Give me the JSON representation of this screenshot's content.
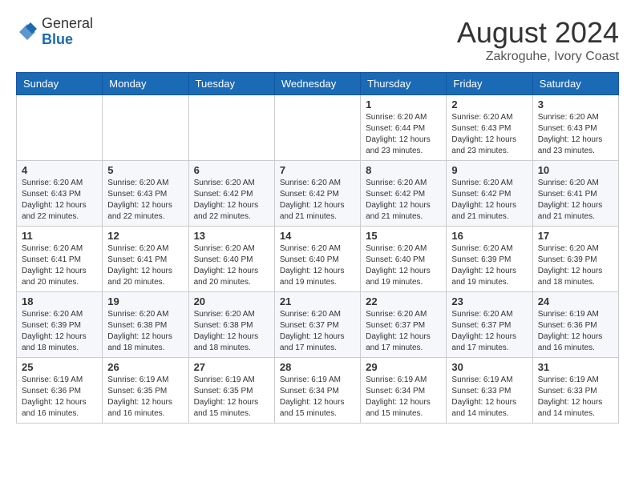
{
  "header": {
    "logo_line1": "General",
    "logo_line2": "Blue",
    "month_year": "August 2024",
    "location": "Zakroguhe, Ivory Coast"
  },
  "weekdays": [
    "Sunday",
    "Monday",
    "Tuesday",
    "Wednesday",
    "Thursday",
    "Friday",
    "Saturday"
  ],
  "weeks": [
    [
      {
        "day": "",
        "info": ""
      },
      {
        "day": "",
        "info": ""
      },
      {
        "day": "",
        "info": ""
      },
      {
        "day": "",
        "info": ""
      },
      {
        "day": "1",
        "info": "Sunrise: 6:20 AM\nSunset: 6:44 PM\nDaylight: 12 hours\nand 23 minutes."
      },
      {
        "day": "2",
        "info": "Sunrise: 6:20 AM\nSunset: 6:43 PM\nDaylight: 12 hours\nand 23 minutes."
      },
      {
        "day": "3",
        "info": "Sunrise: 6:20 AM\nSunset: 6:43 PM\nDaylight: 12 hours\nand 23 minutes."
      }
    ],
    [
      {
        "day": "4",
        "info": "Sunrise: 6:20 AM\nSunset: 6:43 PM\nDaylight: 12 hours\nand 22 minutes."
      },
      {
        "day": "5",
        "info": "Sunrise: 6:20 AM\nSunset: 6:43 PM\nDaylight: 12 hours\nand 22 minutes."
      },
      {
        "day": "6",
        "info": "Sunrise: 6:20 AM\nSunset: 6:42 PM\nDaylight: 12 hours\nand 22 minutes."
      },
      {
        "day": "7",
        "info": "Sunrise: 6:20 AM\nSunset: 6:42 PM\nDaylight: 12 hours\nand 21 minutes."
      },
      {
        "day": "8",
        "info": "Sunrise: 6:20 AM\nSunset: 6:42 PM\nDaylight: 12 hours\nand 21 minutes."
      },
      {
        "day": "9",
        "info": "Sunrise: 6:20 AM\nSunset: 6:42 PM\nDaylight: 12 hours\nand 21 minutes."
      },
      {
        "day": "10",
        "info": "Sunrise: 6:20 AM\nSunset: 6:41 PM\nDaylight: 12 hours\nand 21 minutes."
      }
    ],
    [
      {
        "day": "11",
        "info": "Sunrise: 6:20 AM\nSunset: 6:41 PM\nDaylight: 12 hours\nand 20 minutes."
      },
      {
        "day": "12",
        "info": "Sunrise: 6:20 AM\nSunset: 6:41 PM\nDaylight: 12 hours\nand 20 minutes."
      },
      {
        "day": "13",
        "info": "Sunrise: 6:20 AM\nSunset: 6:40 PM\nDaylight: 12 hours\nand 20 minutes."
      },
      {
        "day": "14",
        "info": "Sunrise: 6:20 AM\nSunset: 6:40 PM\nDaylight: 12 hours\nand 19 minutes."
      },
      {
        "day": "15",
        "info": "Sunrise: 6:20 AM\nSunset: 6:40 PM\nDaylight: 12 hours\nand 19 minutes."
      },
      {
        "day": "16",
        "info": "Sunrise: 6:20 AM\nSunset: 6:39 PM\nDaylight: 12 hours\nand 19 minutes."
      },
      {
        "day": "17",
        "info": "Sunrise: 6:20 AM\nSunset: 6:39 PM\nDaylight: 12 hours\nand 18 minutes."
      }
    ],
    [
      {
        "day": "18",
        "info": "Sunrise: 6:20 AM\nSunset: 6:39 PM\nDaylight: 12 hours\nand 18 minutes."
      },
      {
        "day": "19",
        "info": "Sunrise: 6:20 AM\nSunset: 6:38 PM\nDaylight: 12 hours\nand 18 minutes."
      },
      {
        "day": "20",
        "info": "Sunrise: 6:20 AM\nSunset: 6:38 PM\nDaylight: 12 hours\nand 18 minutes."
      },
      {
        "day": "21",
        "info": "Sunrise: 6:20 AM\nSunset: 6:37 PM\nDaylight: 12 hours\nand 17 minutes."
      },
      {
        "day": "22",
        "info": "Sunrise: 6:20 AM\nSunset: 6:37 PM\nDaylight: 12 hours\nand 17 minutes."
      },
      {
        "day": "23",
        "info": "Sunrise: 6:20 AM\nSunset: 6:37 PM\nDaylight: 12 hours\nand 17 minutes."
      },
      {
        "day": "24",
        "info": "Sunrise: 6:19 AM\nSunset: 6:36 PM\nDaylight: 12 hours\nand 16 minutes."
      }
    ],
    [
      {
        "day": "25",
        "info": "Sunrise: 6:19 AM\nSunset: 6:36 PM\nDaylight: 12 hours\nand 16 minutes."
      },
      {
        "day": "26",
        "info": "Sunrise: 6:19 AM\nSunset: 6:35 PM\nDaylight: 12 hours\nand 16 minutes."
      },
      {
        "day": "27",
        "info": "Sunrise: 6:19 AM\nSunset: 6:35 PM\nDaylight: 12 hours\nand 15 minutes."
      },
      {
        "day": "28",
        "info": "Sunrise: 6:19 AM\nSunset: 6:34 PM\nDaylight: 12 hours\nand 15 minutes."
      },
      {
        "day": "29",
        "info": "Sunrise: 6:19 AM\nSunset: 6:34 PM\nDaylight: 12 hours\nand 15 minutes."
      },
      {
        "day": "30",
        "info": "Sunrise: 6:19 AM\nSunset: 6:33 PM\nDaylight: 12 hours\nand 14 minutes."
      },
      {
        "day": "31",
        "info": "Sunrise: 6:19 AM\nSunset: 6:33 PM\nDaylight: 12 hours\nand 14 minutes."
      }
    ]
  ]
}
